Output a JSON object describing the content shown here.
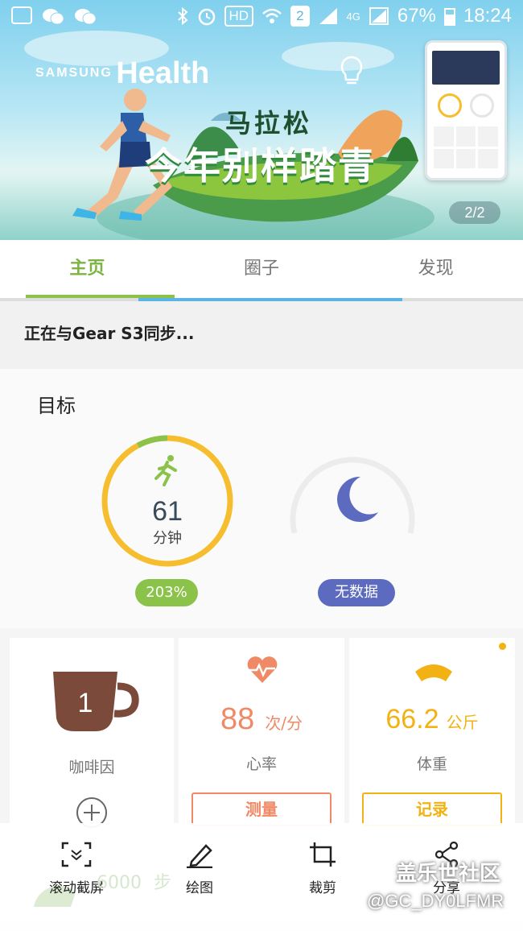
{
  "status_bar": {
    "hd": "HD",
    "sim": "2",
    "network": "4G",
    "battery": "67%",
    "time": "18:24"
  },
  "banner": {
    "brand_small": "SAMSUNG",
    "brand_large": "Health",
    "headline_small": "马拉松",
    "headline_large": "今年别样踏青",
    "page_indicator": "2/2"
  },
  "tabs": [
    {
      "label": "主页",
      "active": true
    },
    {
      "label": "圈子",
      "active": false
    },
    {
      "label": "发现",
      "active": false
    }
  ],
  "sync_message": "正在与Gear S3同步...",
  "goals": {
    "title": "目标",
    "activity": {
      "value": "61",
      "unit": "分钟",
      "percent_label": "203%",
      "progress": 2.03,
      "color": "#f6bd2f",
      "accent": "#8bc34a"
    },
    "sleep": {
      "status": "无数据",
      "color": "#5c6bc0"
    }
  },
  "cards": {
    "caffeine": {
      "count": "1",
      "label": "咖啡因",
      "color": "#7b4a3a"
    },
    "heart_rate": {
      "value": "88",
      "unit": "次/分",
      "label": "心率",
      "button": "测量",
      "color": "#f08a66"
    },
    "weight": {
      "value": "66.2",
      "unit": "公斤",
      "label": "体重",
      "button": "记录",
      "color": "#f2b213"
    }
  },
  "steps_ghost": {
    "value": "6000",
    "unit": "步"
  },
  "toolbar": [
    {
      "label": "滚动截屏",
      "icon": "scroll-capture-icon"
    },
    {
      "label": "绘图",
      "icon": "pencil-icon"
    },
    {
      "label": "裁剪",
      "icon": "crop-icon"
    },
    {
      "label": "分享",
      "icon": "share-icon"
    }
  ],
  "watermark": {
    "site": "盖乐世社区",
    "user": "@GC_DY0LFMR"
  }
}
